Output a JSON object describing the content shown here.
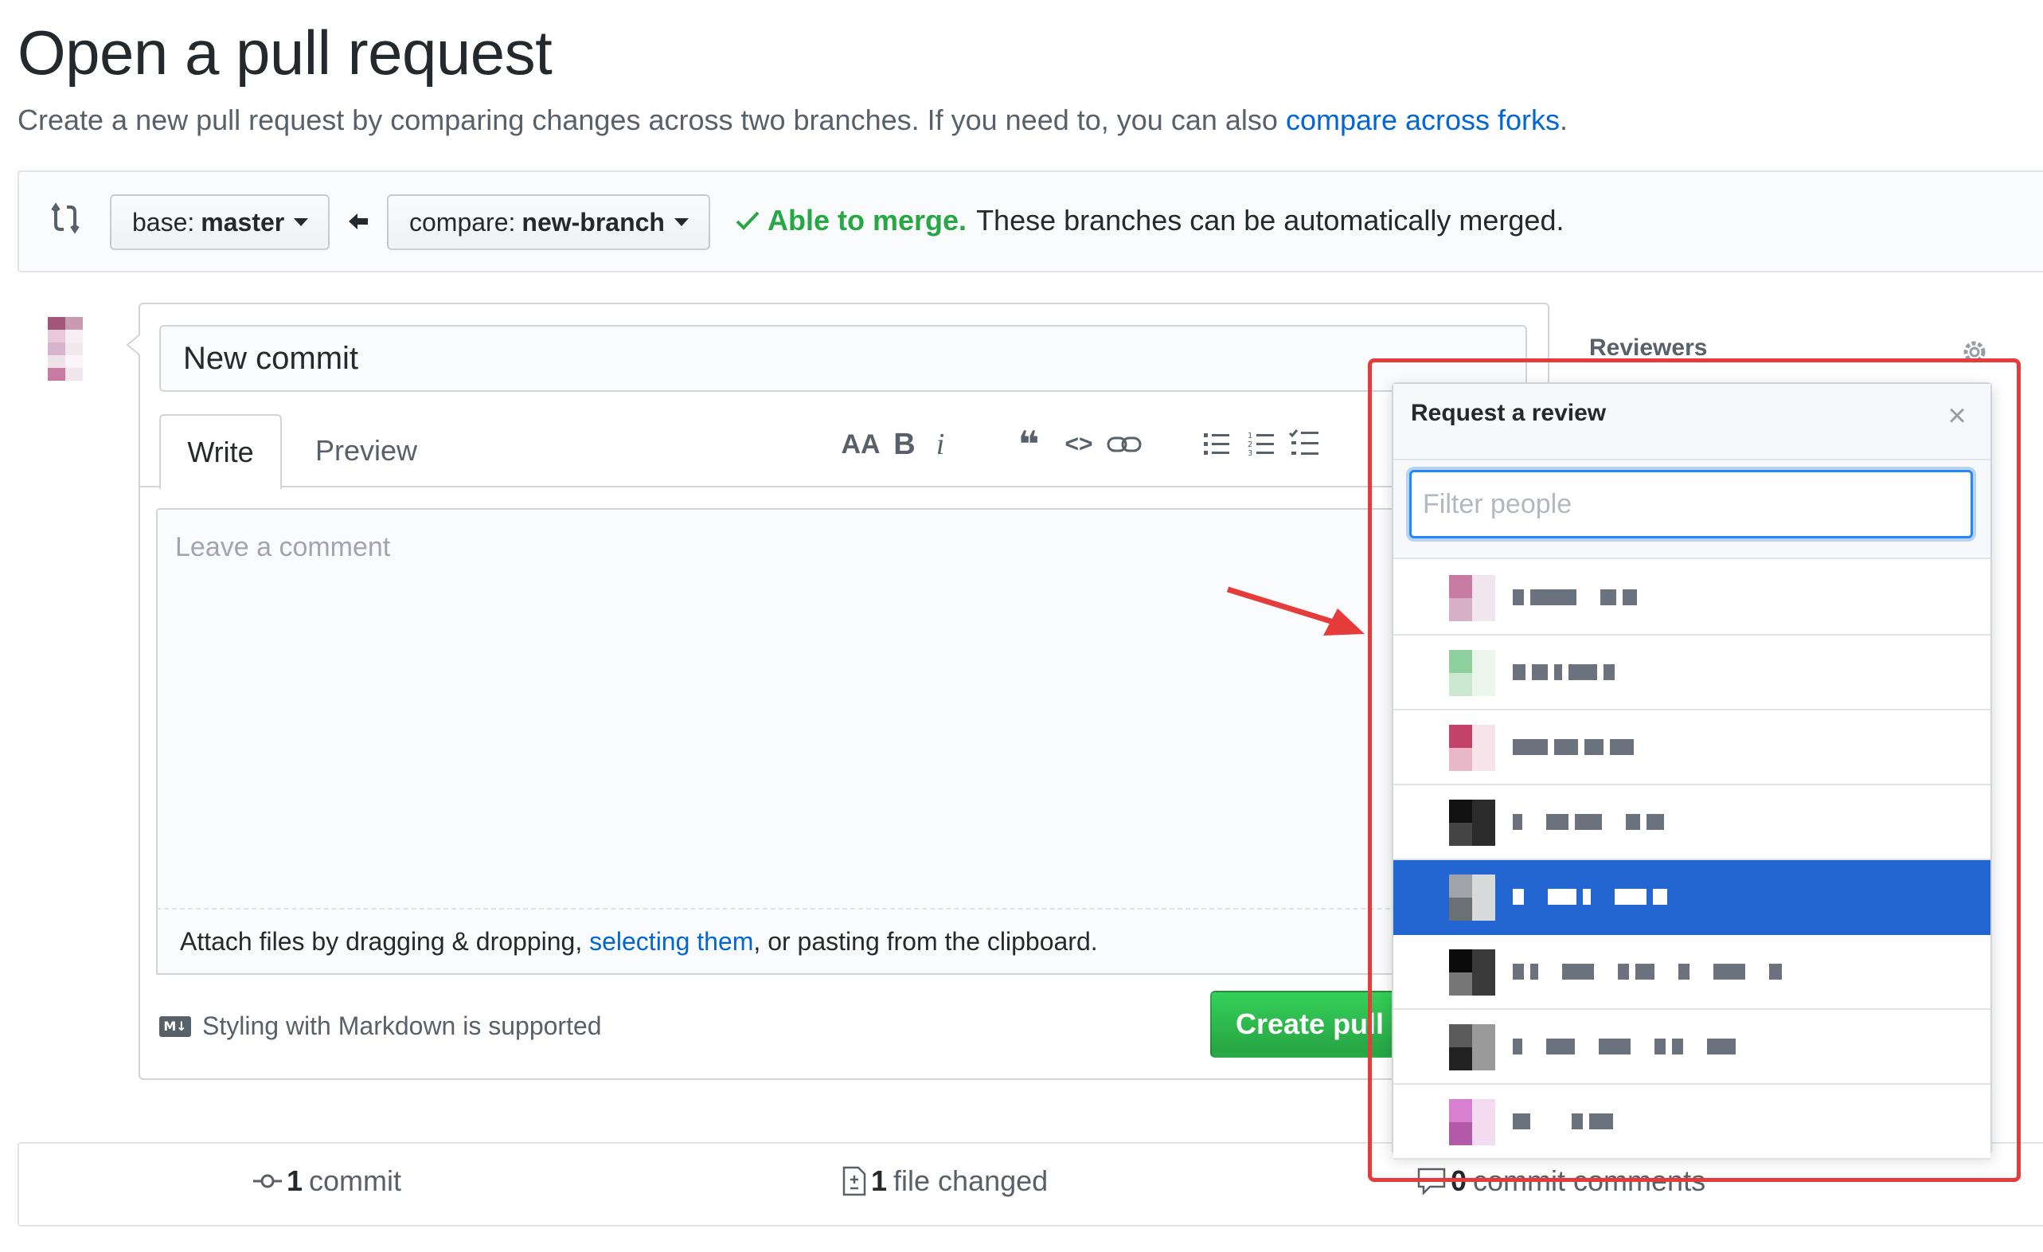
{
  "page": {
    "title": "Open a pull request",
    "subtitle_text": "Create a new pull request by comparing changes across two branches. If you need to, you can also",
    "subtitle_link": "compare across forks",
    "subtitle_end": "."
  },
  "compare": {
    "base_prefix": "base:",
    "base_value": "master",
    "compare_prefix": "compare:",
    "compare_value": "new-branch",
    "merge_ok": "Able to merge.",
    "merge_rest": "These branches can be automatically merged."
  },
  "form": {
    "title_value": "New commit",
    "tabs": [
      "Write",
      "Preview"
    ],
    "comment_placeholder": "Leave a comment",
    "attach_text_1": "Attach files by dragging & dropping,",
    "attach_link": "selecting them",
    "attach_text_2": ", or pasting from the clipboard.",
    "markdown_note": "Styling with Markdown is supported",
    "markdown_badge": "M↓",
    "create_button": "Create pull"
  },
  "toolbar": {
    "heading": "AA",
    "bold": "B",
    "italic": "i",
    "quote": "❝",
    "code": "<>",
    "link": "⊝"
  },
  "stats": {
    "commits_count": "1",
    "commits_label": "commit",
    "files_count": "1",
    "files_label": "file changed",
    "comments_count": "0",
    "comments_label": "commit comments"
  },
  "sidebar": {
    "reviewers_label": "Reviewers"
  },
  "popup": {
    "title": "Request a review",
    "close": "×",
    "filter_placeholder": "Filter people",
    "people": [
      {
        "avatar_colors": [
          "#c77aa2",
          "#f1e6ee",
          "#d6b0c6"
        ],
        "selected": false
      },
      {
        "avatar_colors": [
          "#8fd19e",
          "#eaf6ec",
          "#c9e8cf"
        ],
        "selected": false
      },
      {
        "avatar_colors": [
          "#c2426a",
          "#f7e3ea",
          "#e8b8c8"
        ],
        "selected": false
      },
      {
        "avatar_colors": [
          "#111111",
          "#2b2b2b",
          "#444444"
        ],
        "selected": false
      },
      {
        "avatar_colors": [
          "#a0a4a8",
          "#d8dadc",
          "#6b7075"
        ],
        "selected": true
      },
      {
        "avatar_colors": [
          "#0b0b0b",
          "#3a3a3a",
          "#777777"
        ],
        "selected": false
      },
      {
        "avatar_colors": [
          "#5a5a5a",
          "#9a9a9a",
          "#222222"
        ],
        "selected": false
      },
      {
        "avatar_colors": [
          "#d87fcf",
          "#f3dcef",
          "#b25aa8"
        ],
        "selected": false
      }
    ]
  },
  "colors": {
    "accent_blue": "#0366d6",
    "merge_green": "#28a745",
    "selected_row": "#2366d1",
    "annotation_red": "#e53b3b"
  }
}
